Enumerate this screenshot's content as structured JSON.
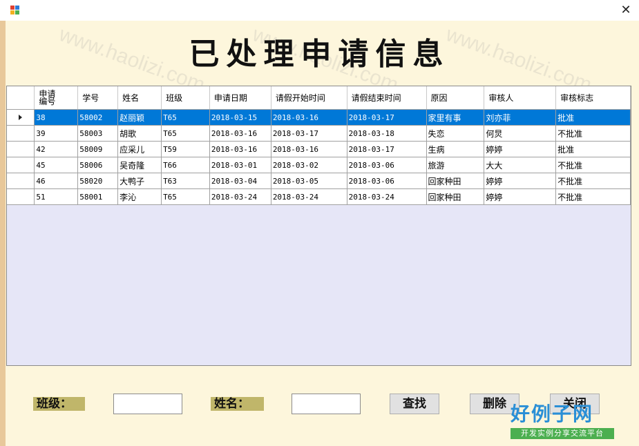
{
  "window": {
    "close_glyph": "✕"
  },
  "title": "已处理申请信息",
  "grid": {
    "columns": [
      "申请编号",
      "学号",
      "姓名",
      "班级",
      "申请日期",
      "请假开始时间",
      "请假结束时间",
      "原因",
      "审核人",
      "审核标志"
    ],
    "column_line1": "申请",
    "column_line2": "编号",
    "rows": [
      [
        "38",
        "58002",
        "赵丽颖",
        "T65",
        "2018-03-15",
        "2018-03-16",
        "2018-03-17",
        "家里有事",
        "刘亦菲",
        "批准"
      ],
      [
        "39",
        "58003",
        "胡歌",
        "T65",
        "2018-03-16",
        "2018-03-17",
        "2018-03-18",
        "失恋",
        "何炅",
        "不批准"
      ],
      [
        "42",
        "58009",
        "应采儿",
        "T59",
        "2018-03-16",
        "2018-03-16",
        "2018-03-17",
        "生病",
        "婷婷",
        "批准"
      ],
      [
        "45",
        "58006",
        "吴奇隆",
        "T66",
        "2018-03-01",
        "2018-03-02",
        "2018-03-06",
        "旅游",
        "大大",
        "不批准"
      ],
      [
        "46",
        "58020",
        "大鸭子",
        "T63",
        "2018-03-04",
        "2018-03-05",
        "2018-03-06",
        "回家种田",
        "婷婷",
        "不批准"
      ],
      [
        "51",
        "58001",
        "李沁",
        "T65",
        "2018-03-24",
        "2018-03-24",
        "2018-03-24",
        "回家种田",
        "婷婷",
        "不批准"
      ]
    ],
    "selected_row": 0
  },
  "filters": {
    "class_label": "班级：",
    "class_value": "",
    "name_label": "姓名：",
    "name_value": ""
  },
  "buttons": {
    "search": "查找",
    "delete": "删除",
    "close": "关闭"
  },
  "watermark": {
    "text": "www.haolizi.com",
    "brand": "好例子网",
    "brand_sub": "开发实例分享交流平台"
  },
  "colors": {
    "selection": "#0078d7",
    "background": "#fdf6dc",
    "grid_bg": "#e6e6f7",
    "label_bg": "#c0b66a"
  }
}
